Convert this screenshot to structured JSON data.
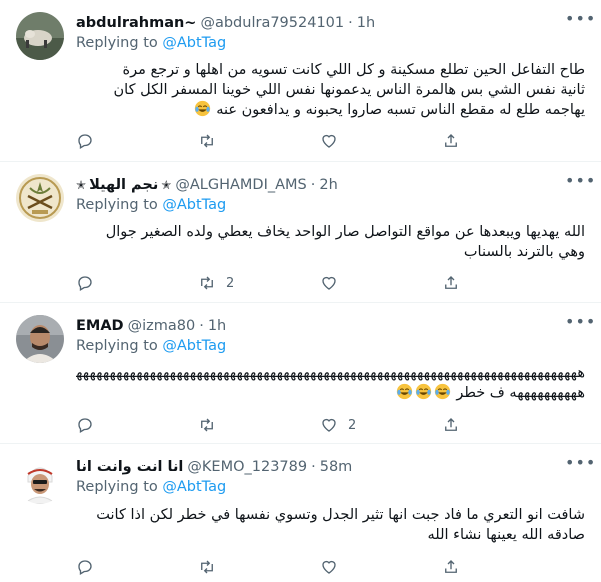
{
  "replying_prefix": "Replying to",
  "mention": "@AbtTag",
  "dot": "·",
  "tweets": [
    {
      "name": "abdulrahman~",
      "handle": "@abdulra79524101",
      "time": "1h",
      "lines": [
        "طاح التفاعل الحين تطلع مسكينة و كل اللي كانت تسويه من اهلها و ترجع مرة",
        "ثانية نفس الشي بس هالمرة الناس يدعمونها نفس اللي خوينا المسفر الكل كان",
        "يهاجمه طلع له مقطع الناس تسبه صاروا يحبونه و يدافعون عنه"
      ],
      "emoji_count": 1,
      "reply_count": "",
      "retweet_count": "",
      "like_count": ""
    },
    {
      "name": "نجم الهيلا",
      "handle": "@ALGHAMDI_AMS",
      "time": "2h",
      "lines": [
        "الله يهديها ويبعدها عن مواقع التواصل صار الواحد يخاف يعطي ولده الصغير جوال",
        "وهي بالترند بالسناب"
      ],
      "emoji_count": 0,
      "reply_count": "",
      "retweet_count": "2",
      "like_count": ""
    },
    {
      "name": "EMAD",
      "handle": "@izma80",
      "time": "1h",
      "lines": [
        "هههههههههههههههههههههههههههههههههههههههههههههههههههههههههههههههههههههههههههههه",
        "ههههههههههه ف خطر"
      ],
      "emoji_count": 3,
      "reply_count": "",
      "retweet_count": "",
      "like_count": "2"
    },
    {
      "name": "انا انت وانت انا",
      "handle": "@KEMO_123789",
      "time": "58m",
      "lines": [
        "شافت انو التعري ما فاد جبت انها تثير الجدل وتسوي نفسها في خطر لكن اذا كانت",
        "صادقه الله يعينها نشاء الله"
      ],
      "emoji_count": 0,
      "reply_count": "",
      "retweet_count": "",
      "like_count": ""
    }
  ]
}
